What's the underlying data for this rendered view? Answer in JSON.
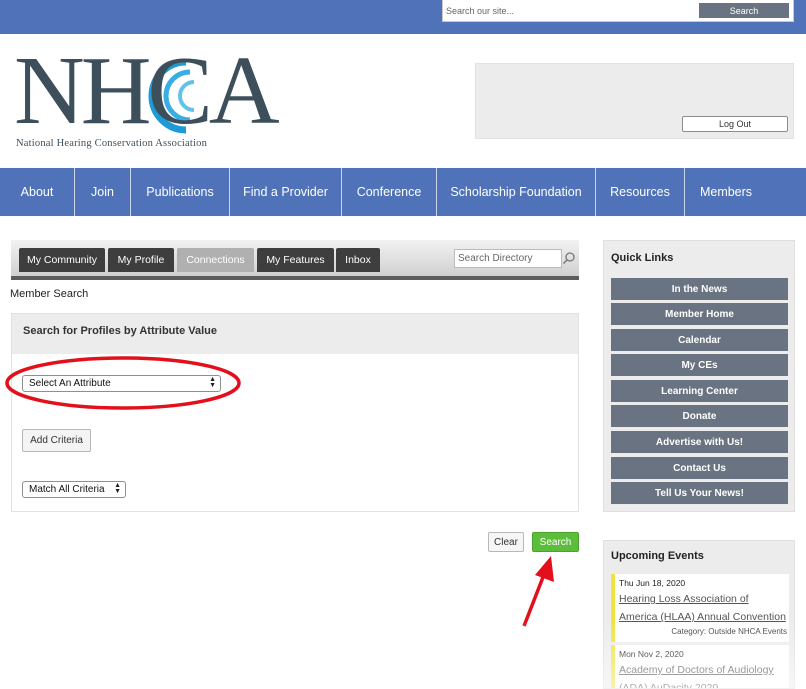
{
  "site_search": {
    "placeholder": "Search our site...",
    "button": "Search"
  },
  "logo": {
    "letters": "NHCA",
    "subtitle": "National Hearing Conservation Association"
  },
  "account": {
    "logout": "Log Out"
  },
  "nav": [
    "About",
    "Join",
    "Publications",
    "Find a Provider",
    "Conference",
    "Scholarship Foundation",
    "Resources",
    "Members"
  ],
  "tabs": {
    "items": [
      "My Community",
      "My Profile",
      "Connections",
      "My Features",
      "Inbox"
    ],
    "active": "Connections"
  },
  "directory_search": {
    "placeholder": "Search Directory"
  },
  "page": {
    "breadcrumb": "Member Search"
  },
  "search_panel": {
    "title": "Search for Profiles by Attribute Value",
    "attribute_select": "Select An Attribute",
    "add_criteria": "Add Criteria",
    "match_select": "Match All Criteria"
  },
  "actions": {
    "clear": "Clear",
    "search": "Search"
  },
  "quick_links": {
    "title": "Quick Links",
    "items": [
      "In the News",
      "Member Home",
      "Calendar",
      "My CEs",
      "Learning Center",
      "Donate",
      "Advertise with Us!",
      "Contact Us",
      "Tell Us Your News!"
    ]
  },
  "upcoming_events": {
    "title": "Upcoming Events",
    "items": [
      {
        "date": "Thu Jun 18, 2020",
        "title": "Hearing Loss Association of America (HLAA) Annual Convention",
        "category": "Category: Outside NHCA Events"
      },
      {
        "date": "Mon Nov 2, 2020",
        "title": "Academy of Doctors of Audiology (ADA) AuDacity 2020",
        "category": ""
      }
    ]
  },
  "colors": {
    "brand_blue": "#4f72b8",
    "quick_link_gray": "#6a7381",
    "search_green": "#5cbd3b",
    "annotation_red": "#e3101b"
  }
}
